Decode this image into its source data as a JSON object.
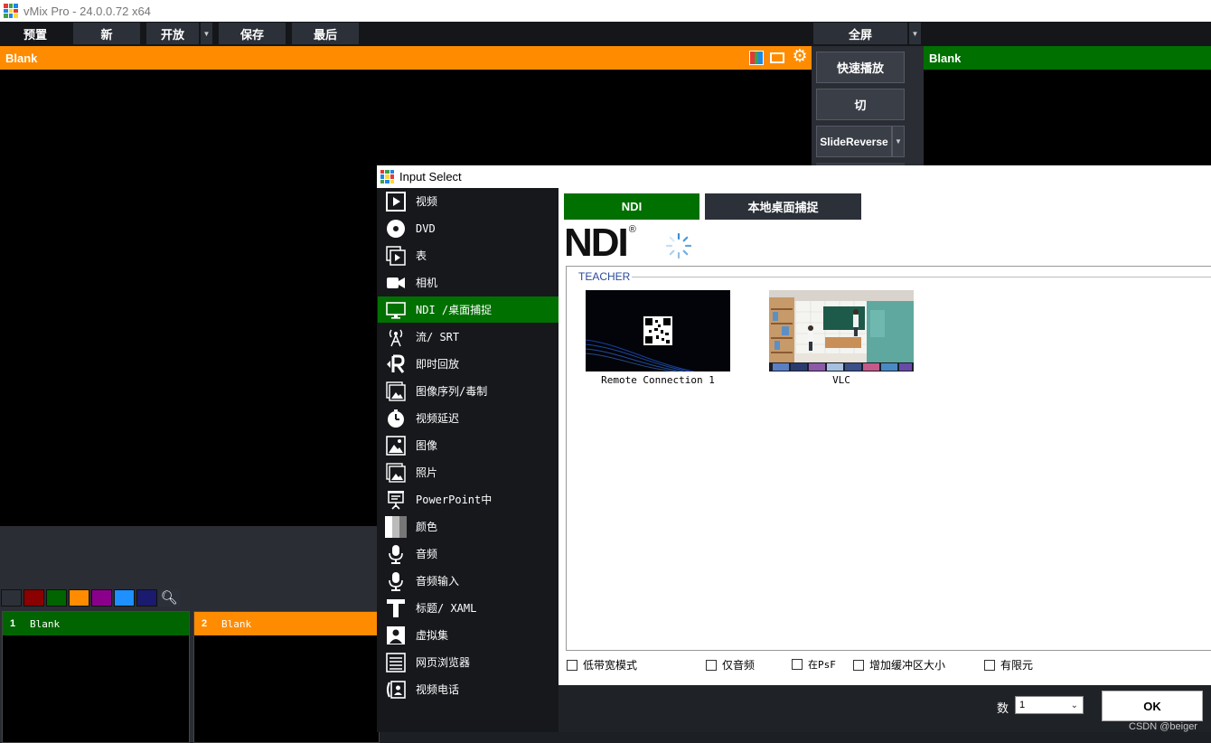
{
  "app": {
    "title": "vMix Pro - 24.0.0.72 x64"
  },
  "menu": {
    "preview": "预置",
    "new": "新",
    "open": "开放",
    "save": "保存",
    "last": "最后",
    "fullscreen": "全屏"
  },
  "preview": {
    "title": "Blank"
  },
  "program": {
    "title": "Blank"
  },
  "transitions": {
    "quick_play": "快速播放",
    "cut": "切",
    "slide_reverse": "SlideReverse"
  },
  "color_swatches": [
    "#2c3038",
    "#8b0000",
    "#006400",
    "#ff8c00",
    "#8b008b",
    "#1e90ff",
    "#1a1a6e"
  ],
  "inputs": [
    {
      "number": "1",
      "name": "Blank",
      "color": "#006400"
    },
    {
      "number": "2",
      "name": "Blank",
      "color": "#ff8c00"
    }
  ],
  "dialog": {
    "title": "Input Select",
    "categories": [
      {
        "label": "视频",
        "icon": "video-icon"
      },
      {
        "label": "DVD",
        "icon": "dvd-icon"
      },
      {
        "label": "表",
        "icon": "list-icon"
      },
      {
        "label": "相机",
        "icon": "camera-icon"
      },
      {
        "label": "NDI /桌面捕捉",
        "icon": "monitor-icon"
      },
      {
        "label": "流/ SRT",
        "icon": "antenna-icon"
      },
      {
        "label": "即时回放",
        "icon": "replay-icon"
      },
      {
        "label": "图像序列/毒制",
        "icon": "image-sequence-icon"
      },
      {
        "label": "视频延迟",
        "icon": "timer-icon"
      },
      {
        "label": "图像",
        "icon": "image-icon"
      },
      {
        "label": "照片",
        "icon": "photos-icon"
      },
      {
        "label": "PowerPoint中",
        "icon": "projector-icon"
      },
      {
        "label": "颜色",
        "icon": "color-icon"
      },
      {
        "label": "音频",
        "icon": "microphone-icon"
      },
      {
        "label": "音频输入",
        "icon": "microphone-input-icon"
      },
      {
        "label": "标题/ XAML",
        "icon": "title-icon"
      },
      {
        "label": "虚拟集",
        "icon": "virtual-set-icon"
      },
      {
        "label": "网页浏览器",
        "icon": "browser-icon"
      },
      {
        "label": "视频电话",
        "icon": "video-call-icon"
      }
    ],
    "selected_category": "NDI /桌面捕捉",
    "tabs": {
      "ndi": "NDI",
      "desktop": "本地桌面捕捉"
    },
    "ndi_logo": "NDI",
    "group": "TEACHER",
    "sources": [
      {
        "label": "Remote Connection 1"
      },
      {
        "label": "VLC"
      }
    ],
    "options": {
      "low_bandwidth": "低带宽模式",
      "audio_only": "仅音频",
      "psf": "在PsF",
      "buffer": "增加缓冲区大小",
      "limited": "有限元"
    },
    "count_label": "数",
    "count_value": "1",
    "ok": "OK"
  },
  "watermark": "CSDN @beiger"
}
